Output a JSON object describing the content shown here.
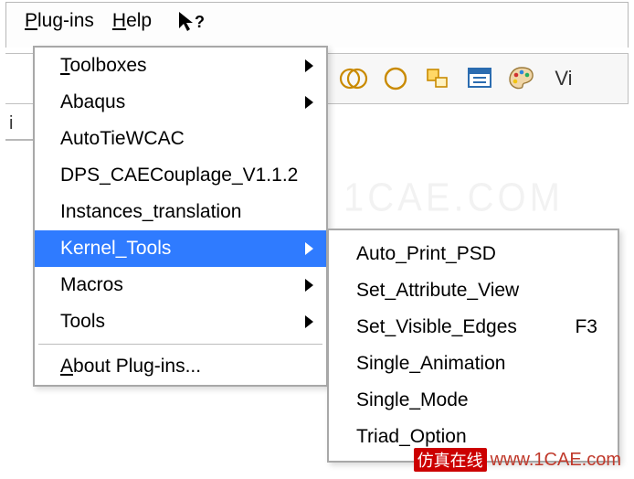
{
  "menubar": {
    "plugins": "Plug-ins",
    "help": "Help"
  },
  "toolbar": {
    "trail_label": "Vi",
    "left_fragment": "i"
  },
  "menu": {
    "toolboxes": "Toolboxes",
    "abaqus": "Abaqus",
    "autotie": "AutoTieWCAC",
    "dps": "DPS_CAECouplage_V1.1.2",
    "instances": "Instances_translation",
    "kernel": "Kernel_Tools",
    "macros": "Macros",
    "tools": "Tools",
    "about": "About Plug-ins..."
  },
  "submenu": {
    "auto_print": "Auto_Print_PSD",
    "set_attr": "Set_Attribute_View",
    "set_visible": "Set_Visible_Edges",
    "set_visible_accel": "F3",
    "single_anim": "Single_Animation",
    "single_mode": "Single_Mode",
    "triad": "Triad_Option"
  },
  "watermark": {
    "faint": "1CAE.COM",
    "cn": "仿真在线",
    "url": "www.1CAE.com"
  }
}
